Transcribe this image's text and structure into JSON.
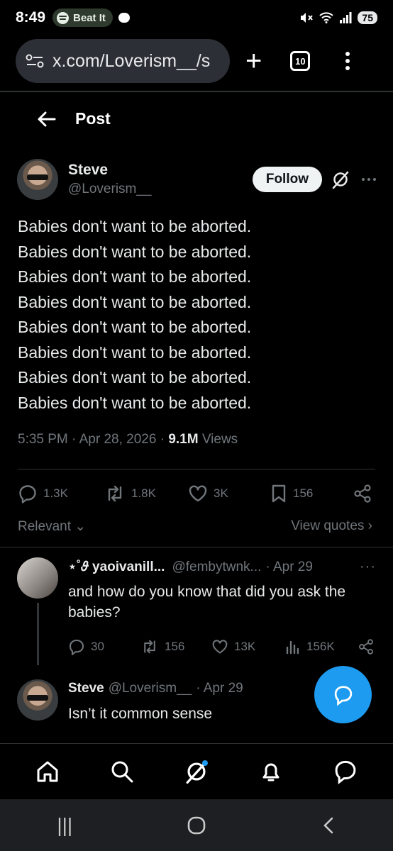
{
  "status_bar": {
    "time": "8:49",
    "app_pill": "Beat It",
    "battery": "75"
  },
  "browser": {
    "url": "x.com/Loverism__/s",
    "tab_count": "10"
  },
  "header": {
    "title": "Post"
  },
  "post": {
    "author_name": "Steve",
    "author_handle": "@Loverism__",
    "follow_label": "Follow",
    "lines": [
      "Babies don't want to be aborted.",
      "Babies don't want to be aborted.",
      "Babies don't want to be aborted.",
      "Babies don't want to be aborted.",
      "Babies don't want to be aborted.",
      "Babies don't want to be aborted.",
      "Babies don't want to be aborted.",
      "Babies don't want to be aborted."
    ],
    "time": "5:35 PM",
    "date": "Apr 28, 2026",
    "views_count": "9.1M",
    "views_label": "Views",
    "replies": "1.3K",
    "reposts": "1.8K",
    "likes": "3K",
    "bookmarks": "156"
  },
  "sort": {
    "left": "Relevant",
    "right": "View quotes"
  },
  "reply1": {
    "name": "⋆˚𝜗 yaoivanill...",
    "handle": "@fembytwnk...",
    "date": "· Apr 29",
    "text": "and how do you know that did you ask the babies?",
    "replies": "30",
    "reposts": "156",
    "likes": "13K",
    "views": "156K"
  },
  "reply2": {
    "name": "Steve",
    "handle": "@Loverism__",
    "date": "· Apr 29",
    "text": "Isn’t it common sense"
  },
  "colors": {
    "accent": "#1d9bf0",
    "background": "#000000",
    "muted": "#71767b"
  }
}
